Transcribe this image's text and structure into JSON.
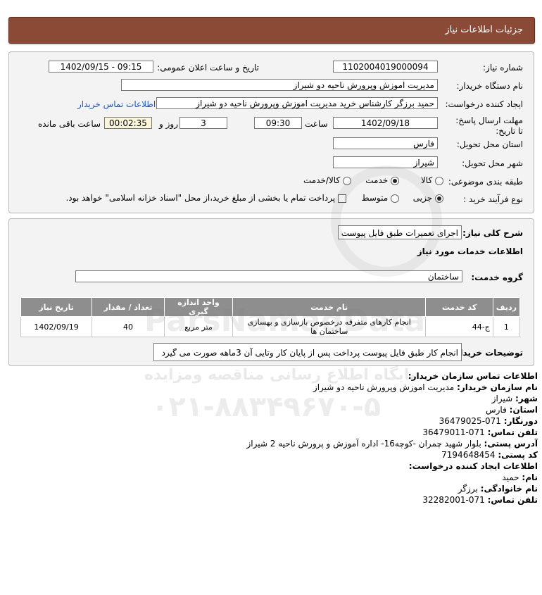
{
  "header": {
    "title": "جزئیات اطلاعات نیاز"
  },
  "form": {
    "need_number_label": "شماره نیاز:",
    "need_number": "1102004019000094",
    "announce_label": "تاریخ و ساعت اعلان عمومی:",
    "announce_value": "1402/09/15 - 09:15",
    "buyer_org_label": "نام دستگاه خریدار:",
    "buyer_org": "مدیریت اموزش وپرورش ناحیه دو شیراز",
    "creator_label": "ایجاد کننده درخواست:",
    "creator": "حمید برزگر کارشناس خرید مدیریت اموزش وپرورش ناحیه دو شیراز",
    "contact_link": "اطلاعات تماس خریدار",
    "deadline_label": "مهلت ارسال پاسخ: تا تاریخ:",
    "deadline_date": "1402/09/18",
    "time_label": "ساعت",
    "deadline_time": "09:30",
    "days": "3",
    "days_label": "روز و",
    "remaining": "00:02:35",
    "remaining_label": "ساعت باقی مانده",
    "province_label": "استان محل تحویل:",
    "province": "فارس",
    "city_label": "شهر محل تحویل:",
    "city": "شیراز",
    "category_label": "طبقه بندی موضوعی:",
    "category_options": [
      "کالا",
      "خدمت",
      "کالا/خدمت"
    ],
    "category_selected": "خدمت",
    "process_label": "نوع فرآیند خرید :",
    "process_options": [
      "جزیی",
      "متوسط"
    ],
    "process_selected": "جزیی",
    "treasury_text": "پرداخت تمام یا بخشی از مبلغ خرید،از محل \"اسناد خزانه اسلامی\" خواهد بود."
  },
  "need": {
    "summary_label": "شرح کلی نیاز:",
    "summary": "اجرای تعمیرات طبق فایل پیوست",
    "services_title": "اطلاعات خدمات مورد نیاز",
    "service_group_label": "گروه خدمت:",
    "service_group": "ساختمان",
    "table": {
      "headers": [
        "ردیف",
        "کد خدمت",
        "نام خدمت",
        "واحد اندازه گیری",
        "تعداد / مقدار",
        "تاریخ نیاز"
      ],
      "rows": [
        {
          "row": "1",
          "code": "ج-44",
          "name": "انجام کارهای متفرقه درخصوص بازسازی و بهسازی ساختمان ها",
          "unit": "متر مربع",
          "qty": "40",
          "date": "1402/09/19"
        }
      ]
    },
    "buyer_notes_label": "توضیحات خریدار:",
    "buyer_notes": "انجام کار طبق فایل پیوست پرداخت پس از پایان کار وتایی آن 3ماهه صورت می گیرد"
  },
  "contact": {
    "org_title": "اطلاعات تماس سازمان خریدار:",
    "org_name_label": "نام سازمان خریدار:",
    "org_name": "مدیریت اموزش وپرورش ناحیه دو شیراز",
    "city_label": "شهر:",
    "city": "شیراز",
    "province_label": "استان:",
    "province": "فارس",
    "fax_label": "دورنگار:",
    "fax": "071-36479025",
    "phone_label": "تلفن تماس:",
    "phone": "071-36479011",
    "address_label": "آدرس پستی:",
    "address": "بلوار شهید چمران -کوچه16- اداره آموزش و پرورش ناحیه 2 شیراز",
    "postal_label": "کد پستی:",
    "postal": "7194648454",
    "creator_title": "اطلاعات ایجاد کننده درخواست:",
    "first_name_label": "نام:",
    "first_name": "حمید",
    "last_name_label": "نام خانوادگی:",
    "last_name": "برزگر",
    "creator_phone_label": "تلفن تماس:",
    "creator_phone": "071-32282001"
  },
  "watermark": {
    "brand": "ParsNamadData",
    "line1": "پایگاه اطلاع رسانی مناقصه ومزایده",
    "phone": "۰۲۱-۸۸۳۴۹۶۷۰-۵"
  }
}
